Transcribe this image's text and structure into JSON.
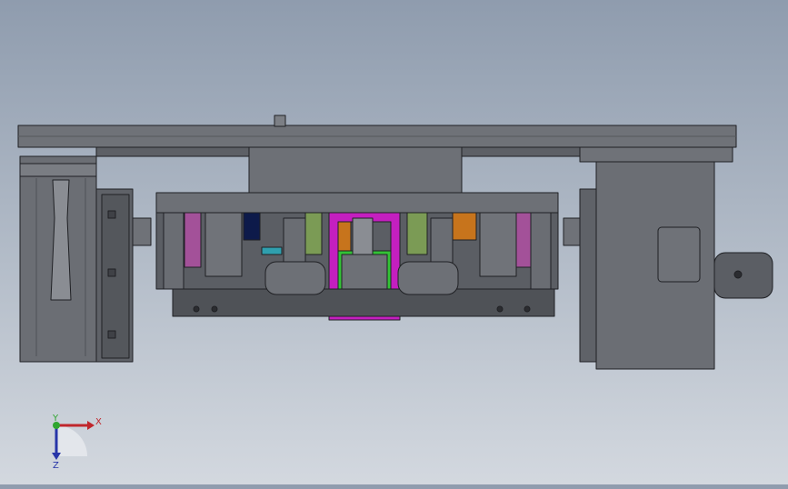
{
  "triad": {
    "x_label": "X",
    "y_label": "Y",
    "z_label": "Z",
    "x_color": "#c0262c",
    "y_color": "#2fa62f",
    "z_color": "#2735a8"
  },
  "colors": {
    "background_top": "#8f9cae",
    "background_bottom": "#d3d8df",
    "part_body": "#6d7076",
    "part_dark": "#4a4c51",
    "part_light": "#8a8d93",
    "edge": "#1f2024",
    "accent_magenta": "#c41fbf",
    "accent_green": "#33c236",
    "accent_orange": "#c7741c",
    "accent_olive": "#7b9b55",
    "accent_pink": "#a35199",
    "accent_navy": "#0d1a4a",
    "accent_teal": "#2f9fae"
  }
}
